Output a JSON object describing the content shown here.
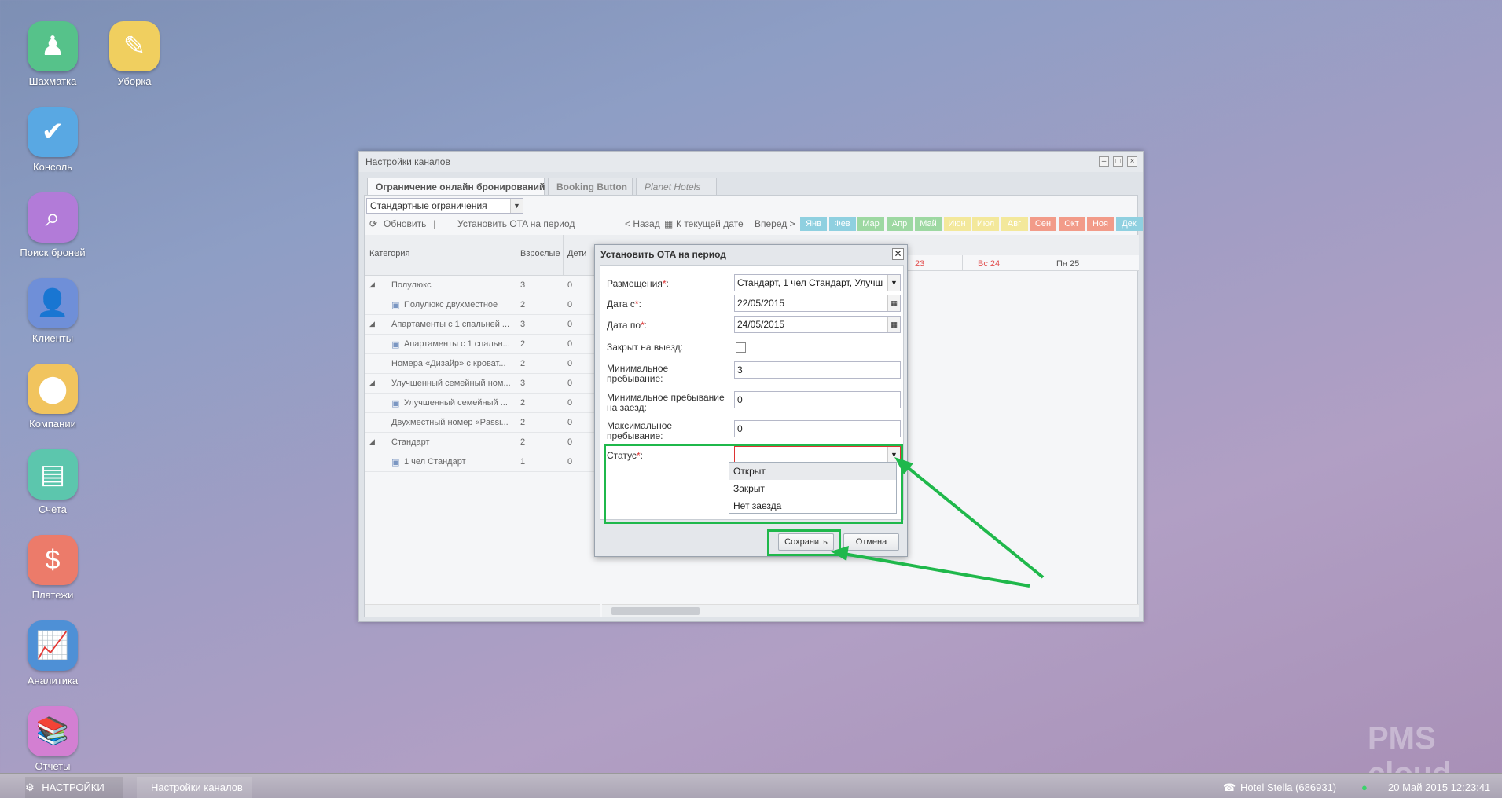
{
  "desktop": {
    "icons": [
      {
        "label": "Шахматка",
        "color": "#56c28a",
        "icon": "chess-pawn-icon"
      },
      {
        "label": "Уборка",
        "color": "#f0cf5f",
        "icon": "broom-icon"
      },
      {
        "label": "Консоль",
        "color": "#59a8e3",
        "icon": "checkmark-icon"
      },
      {
        "label": "Поиск броней",
        "color": "#b27bd8",
        "icon": "magnifier-icon"
      },
      {
        "label": "Клиенты",
        "color": "#6f8fd8",
        "icon": "user-icon"
      },
      {
        "label": "Компании",
        "color": "#f1c45e",
        "icon": "map-pin-icon"
      },
      {
        "label": "Счета",
        "color": "#5cc6ad",
        "icon": "document-icon"
      },
      {
        "label": "Платежи",
        "color": "#ec7b6a",
        "icon": "dollar-icon"
      },
      {
        "label": "Аналитика",
        "color": "#4e90d6",
        "icon": "line-chart-icon"
      },
      {
        "label": "Отчеты",
        "color": "#d37fd2",
        "icon": "books-icon"
      }
    ]
  },
  "window": {
    "title": "Настройки каналов",
    "tabs": [
      "Ограничение онлайн бронирований",
      "Booking Button",
      "Planet Hotels"
    ],
    "restriction_select": "Стандартные ограничения",
    "toolbar": {
      "refresh": "Обновить",
      "set_ota": "Установить OTA на период",
      "back": "< Назад",
      "today": "К текущей дате",
      "forward": "Вперед >"
    },
    "months": [
      {
        "label": "Янв",
        "color": "#8fd0e0"
      },
      {
        "label": "Фев",
        "color": "#8fd0e0"
      },
      {
        "label": "Мар",
        "color": "#9dd8a2"
      },
      {
        "label": "Апр",
        "color": "#9dd8a2"
      },
      {
        "label": "Май",
        "color": "#9dd8a2"
      },
      {
        "label": "Июн",
        "color": "#f3e89b"
      },
      {
        "label": "Июл",
        "color": "#f3e89b"
      },
      {
        "label": "Авг",
        "color": "#f3e89b"
      },
      {
        "label": "Сен",
        "color": "#f29b89"
      },
      {
        "label": "Окт",
        "color": "#f29b89"
      },
      {
        "label": "Ноя",
        "color": "#f29b89"
      },
      {
        "label": "Дек",
        "color": "#8fd0e0"
      }
    ],
    "grid": {
      "headers": {
        "category": "Категория",
        "adults": "Взрослые",
        "children": "Дети"
      },
      "days": [
        "23",
        "Вс 24",
        "Пн 25"
      ],
      "rows": [
        {
          "name": "Полулюкс",
          "adults": "3",
          "children": "0",
          "level": 0
        },
        {
          "name": "Полулюкс двухместное",
          "adults": "2",
          "children": "0",
          "level": 1
        },
        {
          "name": "Апартаменты с 1 спальней ...",
          "adults": "3",
          "children": "0",
          "level": 0
        },
        {
          "name": "Апартаменты с 1 спальн...",
          "adults": "2",
          "children": "0",
          "level": 1
        },
        {
          "name": "Номера «Дизайр» с кроват...",
          "adults": "2",
          "children": "0",
          "level": 2
        },
        {
          "name": "Улучшенный семейный ном...",
          "adults": "3",
          "children": "0",
          "level": 0
        },
        {
          "name": "Улучшенный семейный ...",
          "adults": "2",
          "children": "0",
          "level": 1
        },
        {
          "name": "Двухместный номер «Passi...",
          "adults": "2",
          "children": "0",
          "level": 2
        },
        {
          "name": "Стандарт",
          "adults": "2",
          "children": "0",
          "level": 0
        },
        {
          "name": "1 чел Стандарт",
          "adults": "1",
          "children": "0",
          "level": 1
        }
      ]
    }
  },
  "modal": {
    "title": "Установить OTA на период",
    "fields": {
      "rooms_label": "Размещения",
      "rooms_value": "Стандарт, 1 чел Стандарт, Улучш",
      "date_from_label": "Дата с",
      "date_from_value": "22/05/2015",
      "date_to_label": "Дата по",
      "date_to_value": "24/05/2015",
      "closed_departure_label": "Закрыт на выезд:",
      "min_stay_label_1": "Минимальное",
      "min_stay_label_2": "пребывание:",
      "min_stay_value": "3",
      "min_stay_arrival_label_1": "Минимальное пребывание",
      "min_stay_arrival_label_2": "на заезд:",
      "min_stay_arrival_value": "0",
      "max_stay_label_1": "Максимальное",
      "max_stay_label_2": "пребывание:",
      "max_stay_value": "0",
      "status_label": "Статус",
      "status_value": ""
    },
    "status_options": [
      "Открыт",
      "Закрыт",
      "Нет заезда"
    ],
    "save": "Сохранить",
    "cancel": "Отмена"
  },
  "taskbar": {
    "settings": "НАСТРОЙКИ",
    "window_tab": "Настройки каналов",
    "hotel": "Hotel Stella (686931)",
    "datetime": "20 Май 2015 12:23:41"
  },
  "watermark": "PMS cloud",
  "accent": "#1fb84b"
}
